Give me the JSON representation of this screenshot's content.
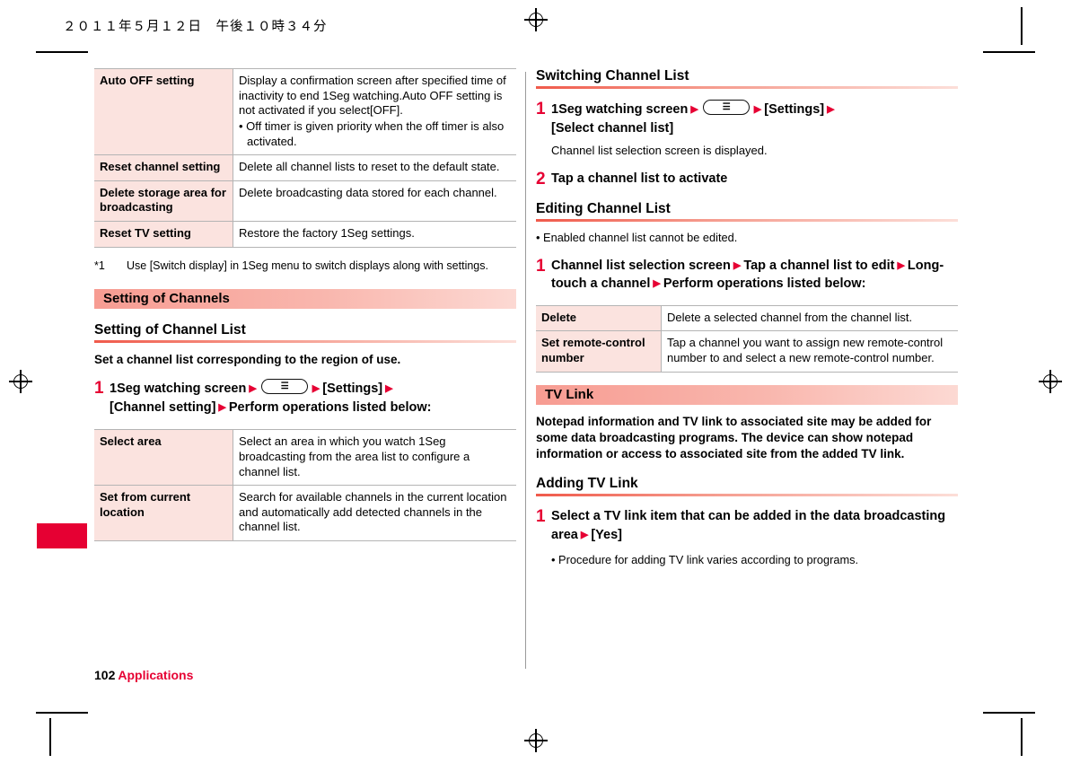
{
  "header": {
    "date_text": "２０１１年５月１２日　午後１０時３４分"
  },
  "footer": {
    "page_number": "102",
    "chapter": "Applications"
  },
  "left_column": {
    "table_settings": {
      "rows": [
        {
          "name": "Auto OFF setting",
          "desc": "Display a confirmation screen after specified time of inactivity to end 1Seg watching.Auto OFF setting is not activated if you select[OFF].",
          "bullet": "• Off timer is given priority when the off timer is also activated."
        },
        {
          "name": "Reset channel setting",
          "desc": "Delete all channel lists to reset to the default state.",
          "bullet": ""
        },
        {
          "name": "Delete storage area for broadcasting",
          "desc": "Delete broadcasting data stored for each channel.",
          "bullet": ""
        },
        {
          "name": "Reset TV setting",
          "desc": "Restore the factory 1Seg settings.",
          "bullet": ""
        }
      ]
    },
    "footnote": {
      "mark": "*1",
      "text": "Use [Switch display] in 1Seg menu to switch displays along with settings."
    },
    "band_title": "Setting of Channels",
    "subhead": "Setting of Channel List",
    "intro_bold": "Set a channel list corresponding to the region of use.",
    "step1": {
      "number": "1",
      "part1": "1Seg watching screen",
      "key_glyph": "☰",
      "part2": "[Settings]",
      "part3": "[Channel setting]",
      "part4": "Perform operations listed below:"
    },
    "table_channel": {
      "rows": [
        {
          "name": "Select area",
          "desc": "Select an area in which you watch 1Seg broadcasting from the area list to configure a channel list."
        },
        {
          "name": "Set from current location",
          "desc": "Search for available channels in the current location and automatically add detected channels in the channel list."
        }
      ]
    }
  },
  "right_column": {
    "subhead_switching": "Switching Channel List",
    "step1": {
      "number": "1",
      "part1": "1Seg watching screen",
      "key_glyph": "☰",
      "part2": "[Settings]",
      "part3": "[Select channel list]",
      "note": "Channel list selection screen is displayed."
    },
    "step2": {
      "number": "2",
      "text": "Tap a channel list to activate"
    },
    "subhead_editing": "Editing Channel List",
    "editing_note": "• Enabled channel list cannot be edited.",
    "step_edit": {
      "number": "1",
      "part1": "Channel list selection screen",
      "part2": "Tap a channel list to edit",
      "part3": "Long-touch a channel",
      "part4": "Perform operations listed below:"
    },
    "table_edit": {
      "rows": [
        {
          "name": "Delete",
          "desc": "Delete a selected channel from the channel list."
        },
        {
          "name": "Set remote-control number",
          "desc": "Tap a channel you want to assign new remote-control number to and select a new remote-control number."
        }
      ]
    },
    "band_title": "TV Link",
    "tvlink_intro": "Notepad information and TV link to associated site may be added for some data broadcasting programs. The device can show notepad information or access to associated site from the added TV link.",
    "subhead_adding": "Adding TV Link",
    "step_add": {
      "number": "1",
      "part1": "Select a TV link item that can be added in the data broadcasting area",
      "part2": "[Yes]",
      "bullet": "• Procedure for adding TV link varies according to programs."
    }
  },
  "colors": {
    "accent_red": "#e60033",
    "band_pink": "#f8a9a0",
    "table_header_pink": "#fbe3df"
  }
}
